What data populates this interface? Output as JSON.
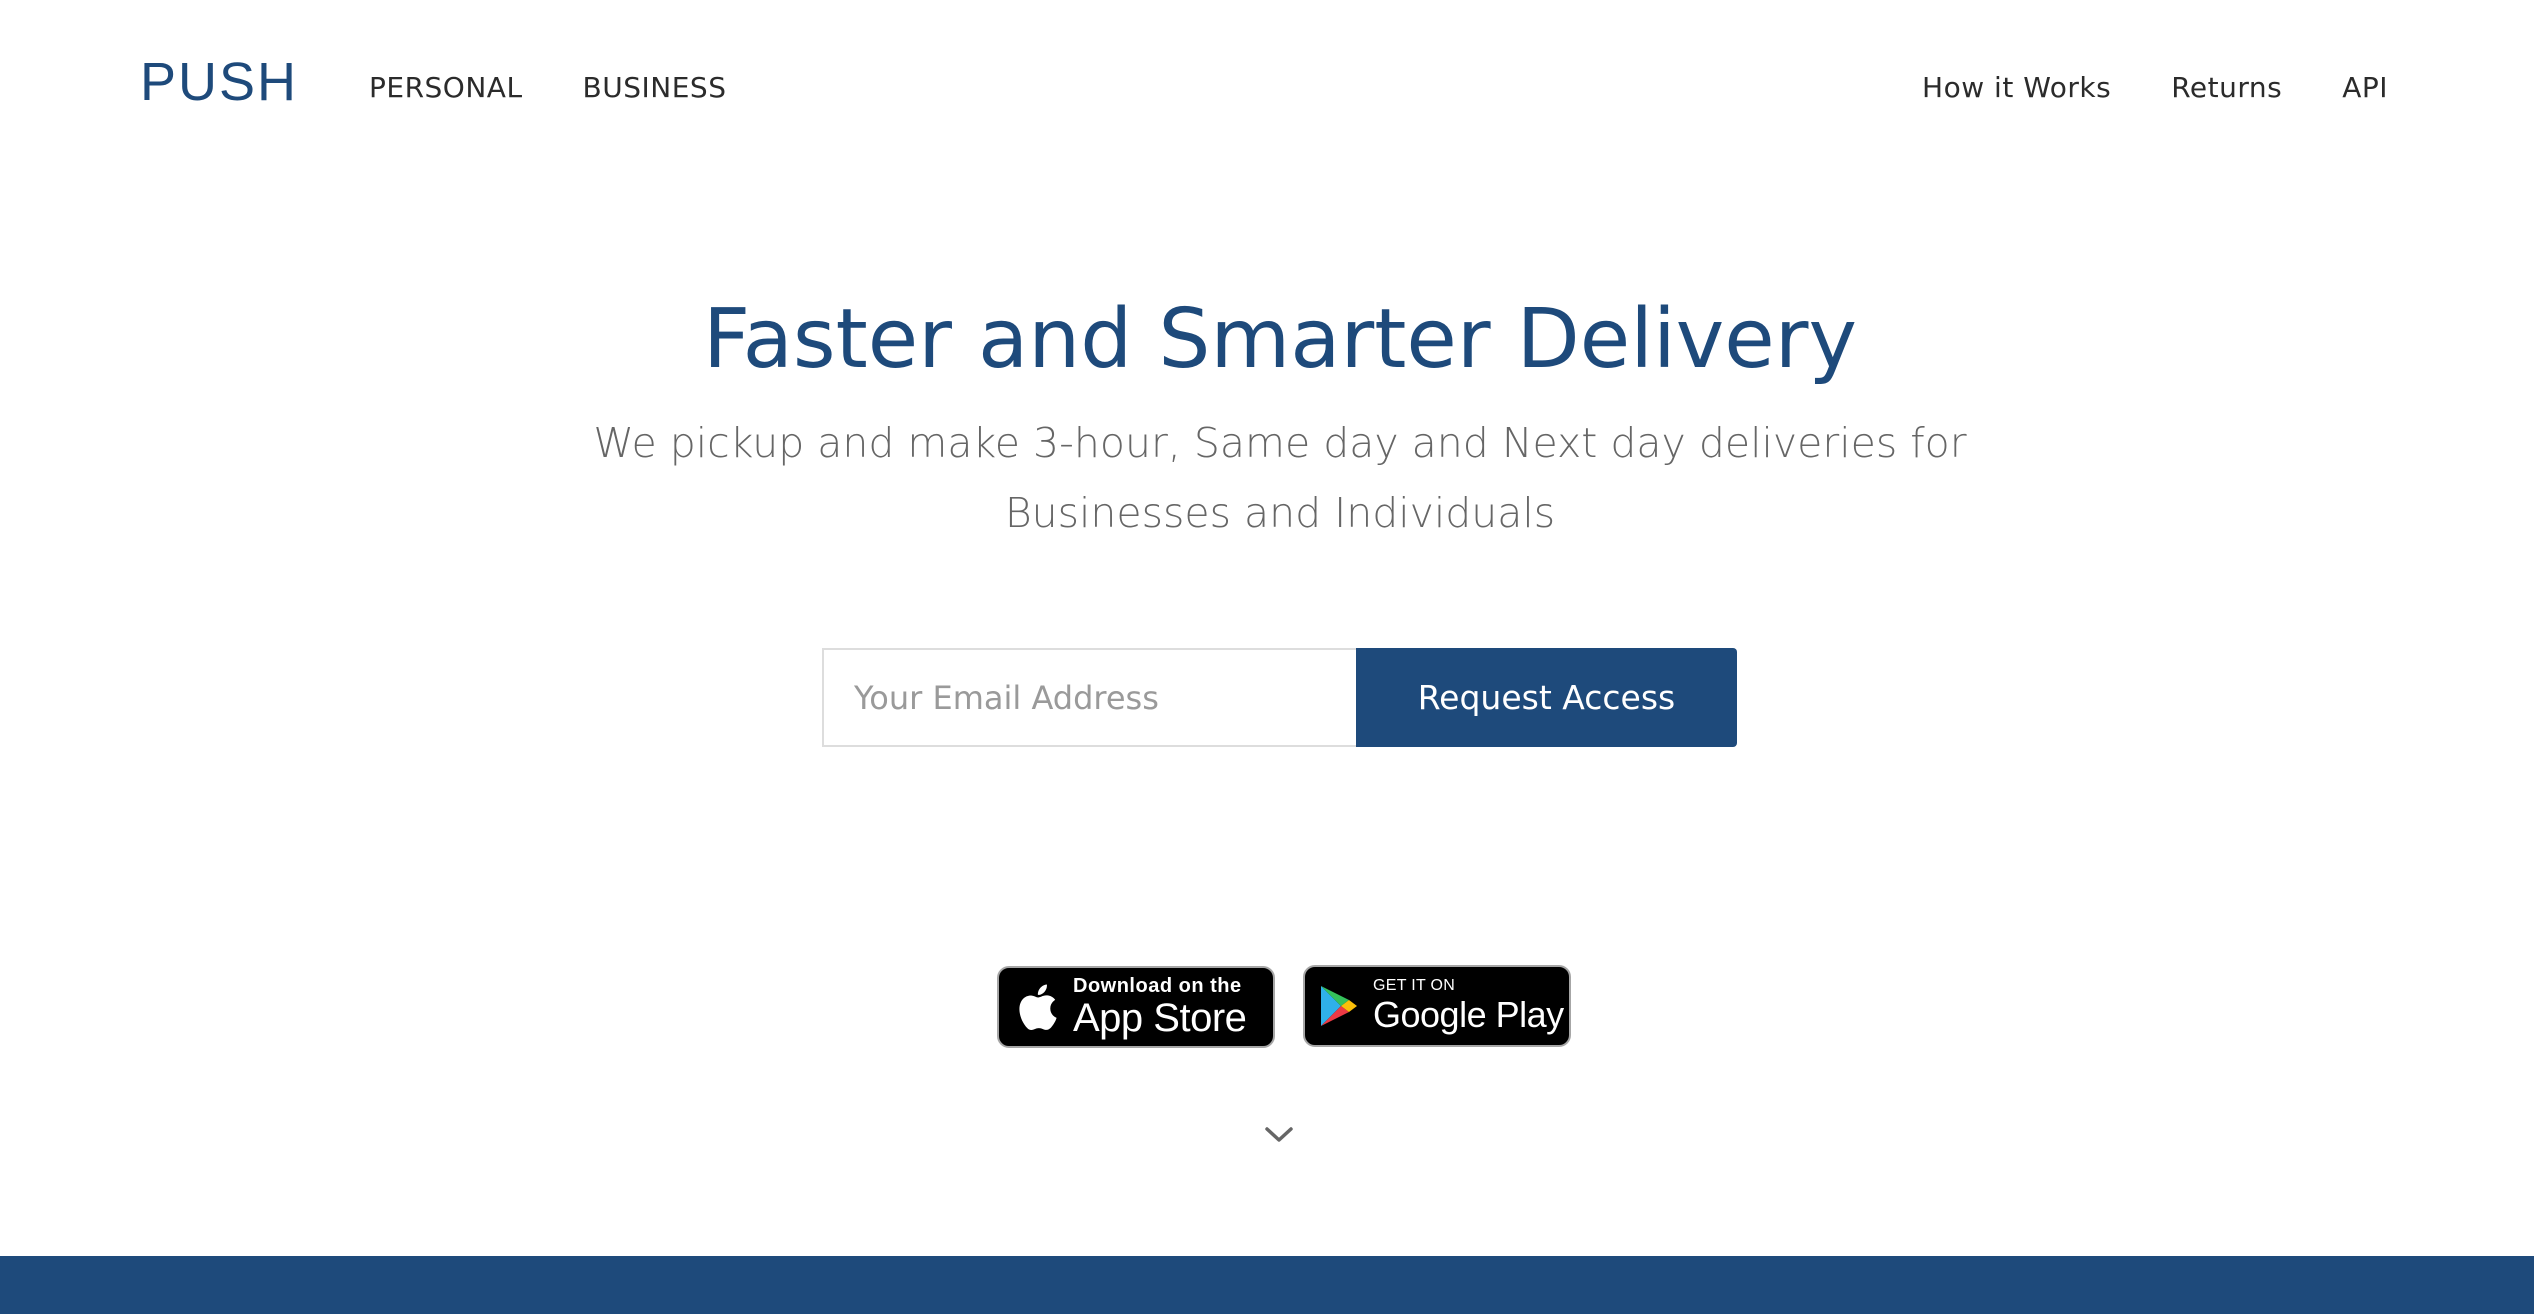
{
  "brand": {
    "logo_text": "PUSH",
    "color": "#1e4a7b"
  },
  "nav": {
    "left": [
      {
        "label": "PERSONAL"
      },
      {
        "label": "BUSINESS"
      }
    ],
    "right": [
      {
        "label": "How it Works"
      },
      {
        "label": "Returns"
      },
      {
        "label": "API"
      }
    ]
  },
  "hero": {
    "title": "Faster and Smarter Delivery",
    "subtitle_line1": "We pickup and make 3-hour, Same day and Next day deliveries for",
    "subtitle_line2": "Businesses and Individuals"
  },
  "signup": {
    "email_placeholder": "Your Email Address",
    "email_value": "",
    "button_label": "Request Access"
  },
  "app_badges": {
    "appstore": {
      "small": "Download on the",
      "big": "App Store",
      "icon": "apple-icon"
    },
    "googleplay": {
      "small": "GET IT ON",
      "big": "Google Play",
      "icon": "google-play-icon"
    }
  },
  "scroll_indicator": {
    "icon": "chevron-down-icon"
  },
  "colors": {
    "primary": "#1e4a7b",
    "text": "#2b2b2b",
    "muted": "#666666"
  }
}
